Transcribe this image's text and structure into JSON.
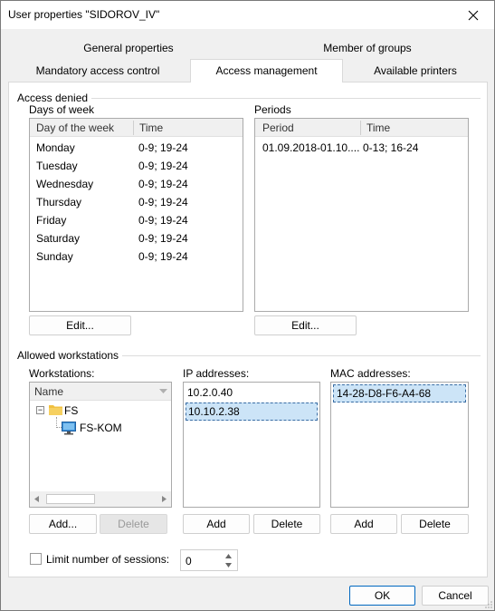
{
  "window": {
    "title": "User properties \"SIDOROV_IV\""
  },
  "tabs": {
    "row1": [
      "General properties",
      "Member of groups"
    ],
    "row2": [
      "Mandatory access control",
      "Access management",
      "Available printers"
    ],
    "selected": "Access management"
  },
  "access_denied": {
    "group_label": "Access denied",
    "days_label": "Days of week",
    "days_columns": [
      "Day of the week",
      "Time"
    ],
    "days_rows": [
      {
        "day": "Monday",
        "time": "0-9; 19-24"
      },
      {
        "day": "Tuesday",
        "time": "0-9; 19-24"
      },
      {
        "day": "Wednesday",
        "time": "0-9; 19-24"
      },
      {
        "day": "Thursday",
        "time": "0-9; 19-24"
      },
      {
        "day": "Friday",
        "time": "0-9; 19-24"
      },
      {
        "day": "Saturday",
        "time": "0-9; 19-24"
      },
      {
        "day": "Sunday",
        "time": "0-9; 19-24"
      }
    ],
    "days_edit_label": "Edit...",
    "periods_label": "Periods",
    "periods_columns": [
      "Period",
      "Time"
    ],
    "periods_rows": [
      {
        "period": "01.09.2018-01.10....",
        "time": "0-13; 16-24"
      }
    ],
    "periods_edit_label": "Edit..."
  },
  "allowed_workstations": {
    "group_label": "Allowed workstations",
    "workstations_label": "Workstations:",
    "tree_column": "Name",
    "tree_items": [
      {
        "label": "FS",
        "icon": "folder-icon",
        "expander": "−"
      },
      {
        "label": "FS-KOM",
        "icon": "computer-icon"
      }
    ],
    "ip_label": "IP addresses:",
    "ip_items": [
      "10.2.0.40",
      "10.10.2.38"
    ],
    "ip_selected": "10.10.2.38",
    "mac_label": "MAC addresses:",
    "mac_items": [
      "14-28-D8-F6-A4-68"
    ],
    "mac_selected": "14-28-D8-F6-A4-68",
    "buttons": {
      "ws_add": "Add...",
      "ws_delete": "Delete",
      "ip_add": "Add",
      "ip_delete": "Delete",
      "mac_add": "Add",
      "mac_delete": "Delete"
    }
  },
  "sessions": {
    "limit_label": "Limit number of sessions:",
    "limit_checked": false,
    "value": "0"
  },
  "footer": {
    "ok_label": "OK",
    "cancel_label": "Cancel"
  },
  "colors": {
    "dialog_bg": "#f0f0f0",
    "selection": "#cce4f7",
    "ok_border": "#0067c0",
    "folder": "#f0c040",
    "monitor": "#3c8fd6"
  }
}
